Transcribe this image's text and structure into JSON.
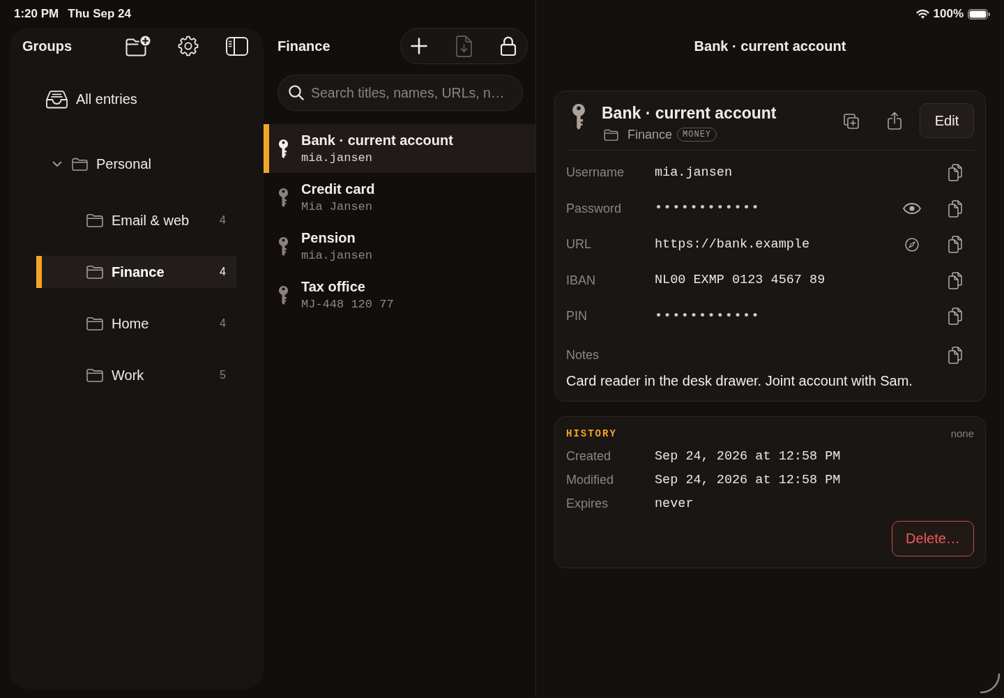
{
  "status_bar": {
    "time": "1:20 PM",
    "date": "Thu Sep 24",
    "battery": "100%"
  },
  "sidebar": {
    "title": "Groups",
    "items": [
      {
        "kind": "all",
        "label": "All entries",
        "selected": false
      },
      {
        "kind": "group",
        "label": "Personal",
        "expanded": true,
        "selected": false,
        "children": [
          {
            "kind": "group",
            "label": "Email & web",
            "count": "4",
            "selected": false
          },
          {
            "kind": "group",
            "label": "Finance",
            "count": "4",
            "selected": true
          },
          {
            "kind": "group",
            "label": "Home",
            "count": "4",
            "selected": false
          },
          {
            "kind": "group",
            "label": "Work",
            "count": "5",
            "selected": false
          }
        ]
      }
    ]
  },
  "list": {
    "title": "Finance",
    "toolbar": [
      {
        "kind": "add",
        "disabled": false
      },
      {
        "kind": "import",
        "disabled": true
      },
      {
        "kind": "lock",
        "disabled": false
      }
    ],
    "search": {
      "placeholder": "Search titles, names, URLs, n…"
    },
    "entries": [
      {
        "title": "Bank · current account",
        "subtitle": "mia.jansen",
        "selected": true
      },
      {
        "title": "Credit card",
        "subtitle": "Mia Jansen",
        "selected": false
      },
      {
        "title": "Pension",
        "subtitle": "mia.jansen",
        "selected": false
      },
      {
        "title": "Tax office",
        "subtitle": "MJ-448 120 77",
        "selected": false
      }
    ]
  },
  "detail": {
    "title": "Bank · current account",
    "entry": {
      "title": "Bank · current account",
      "group": "Finance",
      "tags": [
        "MONEY"
      ],
      "edit": "Edit",
      "fields": [
        {
          "kind": "text",
          "label": "Username",
          "value": "mia.jansen"
        },
        {
          "kind": "password",
          "label": "Password",
          "value": "••••••••••••"
        },
        {
          "kind": "url",
          "label": "URL",
          "value": "https://bank.example"
        },
        {
          "kind": "text",
          "label": "IBAN",
          "value": "NL00 EXMP 0123 4567 89"
        },
        {
          "kind": "pin",
          "label": "PIN",
          "value": "••••••••••••"
        }
      ],
      "notes": {
        "label": "Notes",
        "text": "Card reader in the desk drawer. Joint account with Sam."
      }
    },
    "history": {
      "heading": "HISTORY",
      "note": "none",
      "rows": [
        {
          "label": "Created",
          "value": "Sep 24, 2026 at 12:58 PM"
        },
        {
          "label": "Modified",
          "value": "Sep 24, 2026 at 12:58 PM"
        },
        {
          "label": "Expires",
          "value": "never"
        }
      ],
      "delete": "Delete…"
    }
  }
}
